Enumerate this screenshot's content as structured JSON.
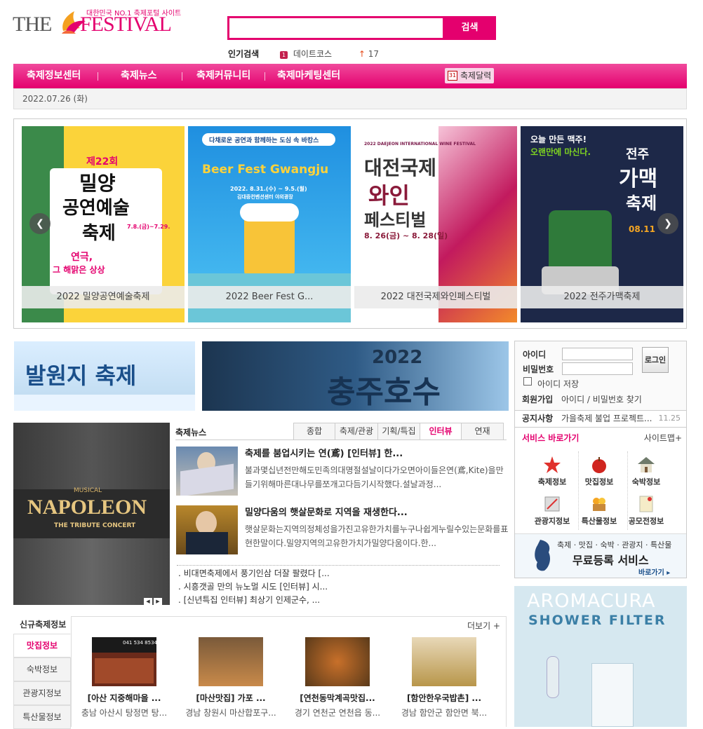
{
  "header": {
    "logo_the": "THE",
    "logo_festival": "FESTIVAL",
    "logo_tagline": "대한민국 NO.1 축제포털 사이트",
    "search_button": "검색",
    "popular_label": "인기검색",
    "popular_rank": "1",
    "popular_keyword": "데이트코스",
    "popular_count": "17"
  },
  "nav": {
    "items": [
      "축제정보센터",
      "축제뉴스",
      "축제커뮤니티",
      "축제마케팅센터"
    ],
    "calendar": "축제달력",
    "calendar_icon_text": "31"
  },
  "date": "2022.07.26 (화)",
  "slider": {
    "captions": [
      "2022 밀양공연예술축제",
      "2022 Beer Fest G...",
      "2022 대전국제와인페스티벌",
      "2022 전주가맥축제"
    ],
    "poster1": {
      "line1": "제22회",
      "line2": "밀양",
      "line3": "공연예술",
      "line4": "축제",
      "dates": "7.8.(금)~7.29.",
      "sub": "연극,",
      "sub2": "그 해맑은 상상"
    },
    "poster2": {
      "top": "다채로운 공연과 함께하는 도심 속 바캉스",
      "title": "Beer Fest Gwangju",
      "dates": "2022. 8.31.(수) ~ 9.5.(월)",
      "place": "김대중컨벤션센터 야외광장"
    },
    "poster3": {
      "top": "2022 DAEJEON INTERNATIONAL WINE FESTIVAL",
      "l1": "대전국제",
      "l2": "와인",
      "l3": "페스티벌",
      "dates": "8. 26(금) ~ 8. 28(일)"
    },
    "poster4": {
      "top": "오늘 만든 맥주!",
      "top2": "오랜만에 마신다.",
      "l1": "전주",
      "l2": "가맥",
      "l3": "축제",
      "dates": "08.11"
    }
  },
  "banners": {
    "left_text": "발원지 축제",
    "right_year": "2022",
    "right_text": "충주호수"
  },
  "login": {
    "id_label": "아이디",
    "pw_label": "비밀번호",
    "button": "로그인",
    "save_id": "아이디 저장",
    "join": "회원가입",
    "find": "아이디 / 비밀번호 찾기"
  },
  "notice": {
    "label": "공지사항",
    "text": "가을축제 불업 프로젝트...",
    "date": "11.25"
  },
  "service": {
    "title": "서비스 바로가기",
    "sitemap": "사이트맵+",
    "items": [
      "축제정보",
      "맛집정보",
      "숙박정보",
      "관광지정보",
      "특산물정보",
      "공모전정보"
    ],
    "free_small": "축제 · 맛집 · 숙박 · 관광지 · 특산물",
    "free_big": "무료등록 서비스",
    "free_link": "바로가기 ▸"
  },
  "ad": {
    "line1": "AROMACURA",
    "line2": "SHOWER FILTER"
  },
  "news": {
    "heading": "축제뉴스",
    "tabs": [
      "종합",
      "축제/관광",
      "기획/특집",
      "인터뷰",
      "연재"
    ],
    "image_musical": "MUSICAL",
    "image_title": "NAPOLEON",
    "image_sub": "THE TRIBUTE CONCERT",
    "stories": [
      {
        "title": "축제를 붐업시키는 연(鳶) [인터뷰] 한...",
        "body": "불과몇십년전만해도민족의대명절설날이다가오면아이들은연(鳶,Kite)을만들기위해마른대나무를쪼개고다듬기시작했다.설날과정..."
      },
      {
        "title": "밀양다움의 햇살문화로 지역을 재생한다...",
        "body": "햇살문화는지역의정체성을가진고유한가치를누구나쉽게누릴수있는문화를표현한말이다.밀양지역의고유한가치가밀양다움이다.한..."
      }
    ],
    "bullets": [
      ". 비대면축제에서 풍기인삼 더잘 팔렸다 [...",
      ". 시흥갯골 만의 뉴노멀 시도 [인터뷰] 시...",
      ". [신년특집 인터뷰] 최상기 인제군수, ..."
    ]
  },
  "newfest": {
    "title": "신규축제정보",
    "more": "더보기 +",
    "side_tabs": [
      "맛집정보",
      "숙박정보",
      "관광지정보",
      "특산물정보"
    ],
    "cards": [
      {
        "title": "[아산 지중해마을 ...",
        "sub": "충남 아산시 탕정면 탕..."
      },
      {
        "title": "[마산맛집] 가포 ...",
        "sub": "경남 창원시 마산합포구..."
      },
      {
        "title": "[연천동막계곡맛집...",
        "sub": "경기 연천군 연천읍 동..."
      },
      {
        "title": "[함안한우국밥촌] ...",
        "sub": "경남 함안군 함안면 북..."
      }
    ],
    "card1_phone": "041 534 8534"
  },
  "colors": {
    "brand": "#e4006e",
    "nav_bg": "#ea2a88"
  }
}
